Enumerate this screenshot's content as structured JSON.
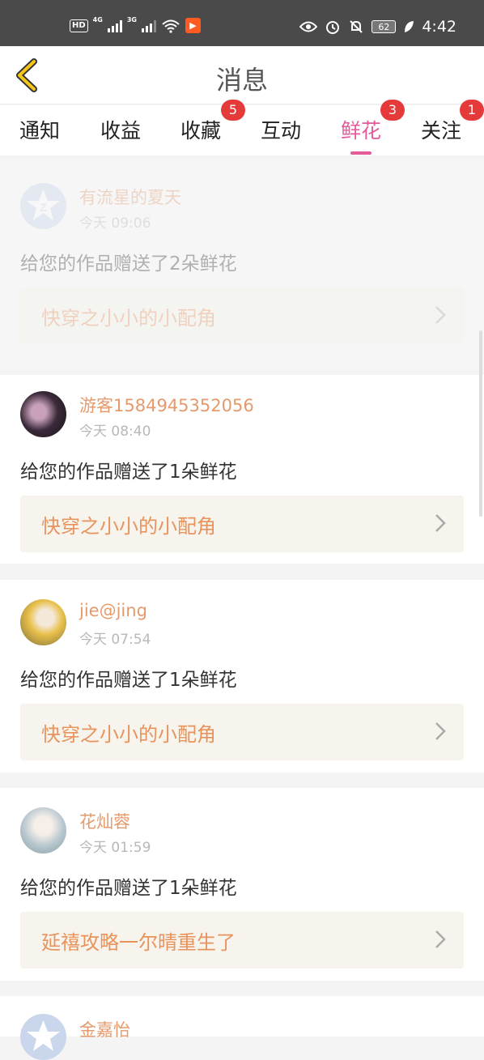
{
  "status": {
    "hd": "HD",
    "net1": "4G",
    "net2": "3G",
    "battery": "62",
    "time": "4:42"
  },
  "header": {
    "title": "消息"
  },
  "tabs": [
    {
      "label": "通知"
    },
    {
      "label": "收益"
    },
    {
      "label": "收藏",
      "badge": "5"
    },
    {
      "label": "互动"
    },
    {
      "label": "鲜花",
      "badge": "3",
      "active": true
    },
    {
      "label": "关注",
      "badge": "1"
    }
  ],
  "items": [
    {
      "name": "有流星的夏天",
      "time": "今天 09:06",
      "message": "给您的作品赠送了2朵鲜花",
      "work": "快穿之小小的小配角",
      "avatar": "default-avatar-icon"
    },
    {
      "name": "游客1584945352056",
      "time": "今天 08:40",
      "message": "给您的作品赠送了1朵鲜花",
      "work": "快穿之小小的小配角",
      "avatar": "photo"
    },
    {
      "name": "jie@jing",
      "time": "今天 07:54",
      "message": "给您的作品赠送了1朵鲜花",
      "work": "快穿之小小的小配角",
      "avatar": "photo"
    },
    {
      "name": "花灿蓉",
      "time": "今天 01:59",
      "message": "给您的作品赠送了1朵鲜花",
      "work": "延禧攻略一尔晴重生了",
      "avatar": "photo"
    },
    {
      "name": "金嘉怡",
      "avatar": "default-avatar-icon"
    }
  ],
  "colors": {
    "accent": "#e45a9a",
    "badge": "#e53a3a",
    "name": "#e59a6c",
    "work_text": "#e8935c",
    "work_bg": "#f6f4ec"
  }
}
